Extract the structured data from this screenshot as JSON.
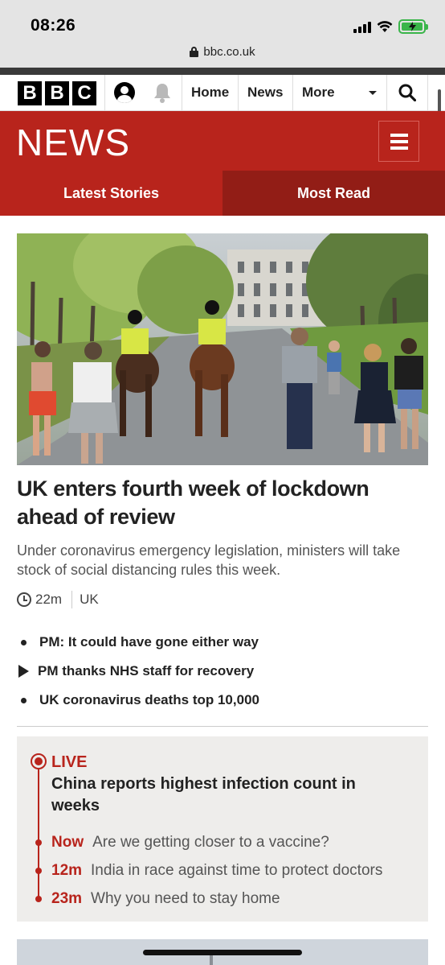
{
  "status_bar": {
    "time": "08:26",
    "battery_color": "#3ab54a"
  },
  "browser": {
    "url": "bbc.co.uk"
  },
  "nav": {
    "logo_letters": [
      "B",
      "B",
      "C"
    ],
    "links": [
      "Home",
      "News",
      "More"
    ],
    "icons": [
      "account-icon",
      "bell-icon",
      "chevron-down-icon",
      "search-icon"
    ]
  },
  "section": {
    "title": "NEWS",
    "brand_color": "#b8241c",
    "tabs": [
      {
        "label": "Latest Stories",
        "active": true
      },
      {
        "label": "Most Read",
        "active": false
      }
    ]
  },
  "lead_story": {
    "headline": "UK enters fourth week of lockdown ahead of review",
    "summary": "Under coronavirus emergency legislation, ministers will take stock of social distancing rules this week.",
    "time_ago": "22m",
    "topic": "UK",
    "related": [
      {
        "label": "PM: It could have gone either way",
        "icon": "bullet"
      },
      {
        "label": "PM thanks NHS staff for recovery",
        "icon": "play-icon"
      },
      {
        "label": "UK coronavirus deaths top 10,000",
        "icon": "bullet"
      }
    ]
  },
  "live": {
    "badge": "LIVE",
    "title": "China reports highest infection count in weeks",
    "entries": [
      {
        "time": "Now",
        "text": "Are we getting closer to a vaccine?"
      },
      {
        "time": "12m",
        "text": "India in race against time to protect doctors"
      },
      {
        "time": "23m",
        "text": "Why you need to stay home"
      }
    ]
  }
}
